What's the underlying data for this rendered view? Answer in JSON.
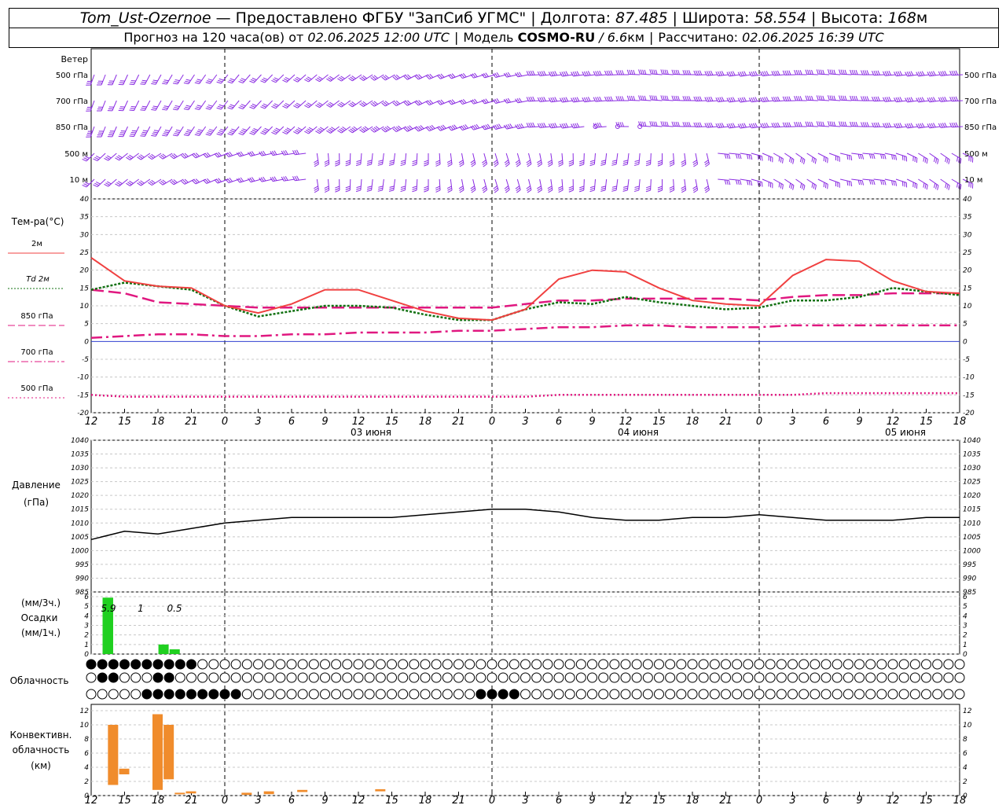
{
  "header": {
    "station": "Tom_Ust-Ozernoe",
    "dash": " — ",
    "provider": "Предоставлено ФГБУ \"ЗапСиб УГМС\"",
    "lon_label": "Долгота: ",
    "lon_value": "87.485",
    "lat_label": "Широта: ",
    "lat_value": "58.554",
    "alt_label": "Высота: ",
    "alt_value": "168",
    "alt_unit": "м",
    "forecast_label": "Прогноз на 120 часа(ов) от ",
    "forecast_time": "02.06.2025 12:00 UTC",
    "model_label": "Модель ",
    "model_name": "COSMO-RU",
    "model_res_sep": " / ",
    "model_res": "6.6",
    "model_res_unit": "км",
    "calc_label": "Рассчитано: ",
    "calc_time": "02.06.2025 16:39 UTC"
  },
  "wind_panel": {
    "title": "Ветер",
    "levels": [
      "500 гПа",
      "700 гПа",
      "850 гПа",
      "500 м",
      "10 м"
    ]
  },
  "temp_panel": {
    "title": "Тем-ра(°C)",
    "legend": [
      {
        "label": "2м",
        "color": "#f04040",
        "dash": "solid"
      },
      {
        "label": "Td  2м",
        "color": "#107010",
        "dash": "dot"
      },
      {
        "label": "850 гПа",
        "color": "#e01880",
        "dash": "longdash"
      },
      {
        "label": "700 гПа",
        "color": "#e01880",
        "dash": "dashdot"
      },
      {
        "label": "500 гПа",
        "color": "#e01880",
        "dash": "dotted"
      }
    ],
    "y_ticks": [
      "40",
      "35",
      "30",
      "25",
      "20",
      "15",
      "10",
      "5",
      "0",
      "-5",
      "-10",
      "-15",
      "-20"
    ]
  },
  "time_axis": {
    "hour_labels": [
      "12",
      "15",
      "18",
      "21",
      "0",
      "3",
      "6",
      "9",
      "12",
      "15",
      "18",
      "21",
      "0",
      "3",
      "6",
      "9",
      "12",
      "15",
      "18",
      "21",
      "0",
      "3",
      "6",
      "9",
      "12",
      "15",
      "18"
    ],
    "dates": [
      "03 июня",
      "04 июня",
      "05 июня"
    ]
  },
  "pressure_panel": {
    "title": "Давление",
    "unit": "(гПа)",
    "y_ticks": [
      "1040",
      "1035",
      "1030",
      "1025",
      "1020",
      "1015",
      "1010",
      "1005",
      "1000",
      "995",
      "990",
      "985"
    ]
  },
  "precip_panel": {
    "title": "Осадки",
    "unit_top": "(мм/3ч.)",
    "unit_bottom": "(мм/1ч.)",
    "y_ticks": [
      "6",
      "5",
      "4",
      "3",
      "2",
      "1",
      "0"
    ],
    "annotations": [
      "5.9",
      "1",
      "0.5"
    ]
  },
  "cloud_panel": {
    "title": "Облачность"
  },
  "conv_panel": {
    "title_1": "Конвективн.",
    "title_2": "облачность",
    "unit": "(км)",
    "y_ticks": [
      "12",
      "10",
      "8",
      "6",
      "4",
      "2",
      "0"
    ]
  },
  "chart_data": {
    "type": "line",
    "title": "Tom_Ust-Ozernoe",
    "x_hours_from_start": [
      0,
      3,
      6,
      9,
      12,
      15,
      18,
      21,
      24,
      27,
      30,
      33,
      36,
      39,
      42,
      45,
      48,
      51,
      54,
      57,
      60,
      63,
      66,
      69,
      72,
      75,
      78
    ],
    "temperature_2m": [
      23.5,
      17,
      15.5,
      15,
      10,
      8,
      10.5,
      14.5,
      14.5,
      11.5,
      8.5,
      6.5,
      6,
      9,
      17.5,
      20,
      19.5,
      15,
      11.5,
      10.5,
      10,
      18.5,
      23,
      22.5,
      17,
      14,
      13.5
    ],
    "dewpoint_2m": [
      14.5,
      16.5,
      15.5,
      14.5,
      10,
      7,
      8.5,
      10,
      10,
      9.5,
      7.5,
      6,
      6,
      9,
      11,
      10.5,
      12.5,
      11,
      10,
      9,
      9.5,
      11.5,
      11.5,
      12.5,
      15,
      14,
      13
    ],
    "t850": [
      14.5,
      13.5,
      11,
      10.5,
      10,
      9.5,
      9.5,
      9.5,
      9.5,
      9.5,
      9.5,
      9.5,
      9.5,
      10.5,
      11.5,
      11.5,
      12,
      12,
      12,
      12,
      11.5,
      12.5,
      13,
      13,
      13.5,
      13.5,
      13.5
    ],
    "t700": [
      1,
      1.5,
      2,
      2,
      1.5,
      1.5,
      2,
      2,
      2.5,
      2.5,
      2.5,
      3,
      3,
      3.5,
      4,
      4,
      4.5,
      4.5,
      4,
      4,
      4,
      4.5,
      4.5,
      4.5,
      4.5,
      4.5,
      4.5
    ],
    "t500": [
      -15,
      -15.5,
      -15.5,
      -15.5,
      -15.5,
      -15.5,
      -15.5,
      -15.5,
      -15.5,
      -15.5,
      -15.5,
      -15.5,
      -15.5,
      -15.5,
      -15,
      -15,
      -15,
      -15,
      -15,
      -15,
      -15,
      -15,
      -14.5,
      -14.5,
      -14.5,
      -14.5,
      -14.5
    ],
    "pressure_hpa": [
      1004,
      1007,
      1006,
      1008,
      1010,
      1011,
      1012,
      1012,
      1012,
      1012,
      1013,
      1014,
      1015,
      1015,
      1014,
      1012,
      1011,
      1011,
      1012,
      1012,
      1013,
      1012,
      1011,
      1011,
      1011,
      1012,
      1012
    ],
    "precip_bars": [
      {
        "hour": 1.5,
        "value": 5.9,
        "color": "#20d020"
      },
      {
        "hour": 6.5,
        "value": 1.0,
        "color": "#20d020"
      },
      {
        "hour": 7.5,
        "value": 0.5,
        "color": "#20d020"
      }
    ],
    "convective_cloud_km": [
      {
        "hour": 2,
        "bottom": 1.5,
        "top": 10
      },
      {
        "hour": 3,
        "bottom": 3,
        "top": 3.8
      },
      {
        "hour": 6,
        "bottom": 0.8,
        "top": 11.5
      },
      {
        "hour": 7,
        "bottom": 2.3,
        "top": 10
      },
      {
        "hour": 8,
        "bottom": 0.2,
        "top": 0.4
      },
      {
        "hour": 9,
        "bottom": 0.3,
        "top": 0.6
      },
      {
        "hour": 14,
        "bottom": 0.1,
        "top": 0.4
      },
      {
        "hour": 16,
        "bottom": 0.2,
        "top": 0.6
      },
      {
        "hour": 19,
        "bottom": 0.5,
        "top": 0.8
      },
      {
        "hour": 26,
        "bottom": 0.6,
        "top": 0.9
      }
    ],
    "ylim_temp": [
      -20,
      40
    ],
    "ylim_pressure": [
      985,
      1040
    ],
    "ylim_precip": [
      0,
      6
    ],
    "ylim_conv": [
      0,
      12
    ]
  }
}
